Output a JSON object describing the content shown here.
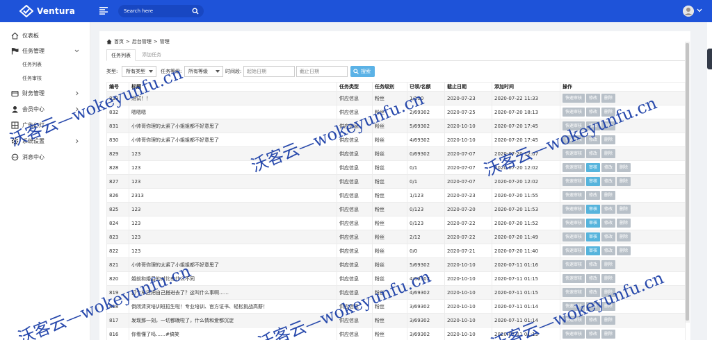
{
  "app": {
    "name": "Ventura"
  },
  "search": {
    "placeholder": "Search here"
  },
  "colors": {
    "topbar": "#1e53d9",
    "accent": "#5bb2e6",
    "review_button": "#56b4dc",
    "action_button": "#b8c0c8"
  },
  "sidebar": {
    "items": [
      {
        "label": "仪表板",
        "icon": "home-icon"
      },
      {
        "label": "任务管理",
        "icon": "flag-icon",
        "expanded": true,
        "children": [
          {
            "label": "任务列表"
          },
          {
            "label": "任务审核"
          }
        ]
      },
      {
        "label": "财务管理",
        "icon": "wallet-icon"
      },
      {
        "label": "会员中心",
        "icon": "user-icon"
      },
      {
        "label": "广告幻灯",
        "icon": "grid-icon"
      },
      {
        "label": "系统设置",
        "icon": "gear-icon"
      },
      {
        "label": "消息中心",
        "icon": "message-icon"
      }
    ]
  },
  "breadcrumb": {
    "items": [
      "首页",
      "后台管理",
      "管理"
    ],
    "separator": ">"
  },
  "tabs": [
    {
      "label": "任务列表",
      "active": true
    },
    {
      "label": "添加任务",
      "active": false
    }
  ],
  "filters": {
    "type_label": "类型:",
    "type_value": "所有类型",
    "level_label": "任务等级:",
    "level_value": "所有等级",
    "time_label": "时间段:",
    "start_placeholder": "起始日期",
    "end_placeholder": "截止日期",
    "search_button": "搜索"
  },
  "table": {
    "columns": [
      "编号",
      "标题",
      "任务类型",
      "任务级别",
      "已领/名额",
      "截止日期",
      "添加时间",
      "操作"
    ],
    "action_labels": {
      "quick": "快速审核",
      "review": "审核",
      "edit": "修改",
      "delete": "删除"
    },
    "rows": [
      {
        "id": "833",
        "title": "测试！！",
        "type": "供应信息",
        "level": "粉丝",
        "quota": "1/100",
        "deadline": "2020-07-23",
        "added": "2020-07-22 11:33",
        "review": false
      },
      {
        "id": "832",
        "title": "嗯嗯嗯",
        "type": "供应信息",
        "level": "粉丝",
        "quota": "2/69302",
        "deadline": "2020-07-25",
        "added": "2020-07-20 18:13",
        "review": false
      },
      {
        "id": "831",
        "title": "小帅哥你理的太紧了小姐姐都不好意思了",
        "type": "供应信息",
        "level": "粉丝",
        "quota": "5/69302",
        "deadline": "2020-10-10",
        "added": "2020-07-20 17:45",
        "review": false
      },
      {
        "id": "830",
        "title": "小帅哥你理的太紧了小姐姐都不好意思了",
        "type": "供应信息",
        "level": "粉丝",
        "quota": "4/69302",
        "deadline": "2020-10-10",
        "added": "2020-07-20 17:45",
        "review": false
      },
      {
        "id": "829",
        "title": "123",
        "type": "供应信息",
        "level": "粉丝",
        "quota": "0/69302",
        "deadline": "2020-07-07",
        "added": "2020-07-20 12:07",
        "review": false
      },
      {
        "id": "828",
        "title": "123",
        "type": "供应信息",
        "level": "粉丝",
        "quota": "0/1",
        "deadline": "2020-07-07",
        "added": "2020-07-20 12:02",
        "review": true
      },
      {
        "id": "827",
        "title": "123",
        "type": "供应信息",
        "level": "粉丝",
        "quota": "0/1",
        "deadline": "2020-07-07",
        "added": "2020-07-20 12:02",
        "review": true
      },
      {
        "id": "826",
        "title": "2313",
        "type": "供应信息",
        "level": "粉丝",
        "quota": "1/123",
        "deadline": "2020-07-23",
        "added": "2020-07-20 11:55",
        "review": false
      },
      {
        "id": "825",
        "title": "123",
        "type": "供应信息",
        "level": "粉丝",
        "quota": "0/123",
        "deadline": "2020-07-20",
        "added": "2020-07-20 11:53",
        "review": true
      },
      {
        "id": "824",
        "title": "123",
        "type": "供应信息",
        "level": "粉丝",
        "quota": "0/123",
        "deadline": "2020-07-22",
        "added": "2020-07-20 11:52",
        "review": true
      },
      {
        "id": "823",
        "title": "123",
        "type": "供应信息",
        "level": "粉丝",
        "quota": "2/12",
        "deadline": "2020-07-22",
        "added": "2020-07-20 11:49",
        "review": true
      },
      {
        "id": "822",
        "title": "123",
        "type": "供应信息",
        "level": "粉丝",
        "quota": "0/0",
        "deadline": "2020-07-21",
        "added": "2020-07-20 11:40",
        "review": true
      },
      {
        "id": "821",
        "title": "小帅哥你理的太紧了小姐姐都不好意思了",
        "type": "供应信息",
        "level": "粉丝",
        "quota": "5/69302",
        "deadline": "2020-10-10",
        "added": "2020-07-11 01:16",
        "review": false
      },
      {
        "id": "820",
        "title": "婚前和婚后的对比有什么不同",
        "type": "供应信息",
        "level": "粉丝",
        "quota": "4/69302",
        "deadline": "2020-10-10",
        "added": "2020-07-11 01:15",
        "review": false
      },
      {
        "id": "819",
        "title": "打个车还把自己搭进去了？这叫什么事啊……",
        "type": "供应信息",
        "level": "粉丝",
        "quota": "4/69302",
        "deadline": "2020-10-10",
        "added": "2020-07-11 01:15",
        "review": false
      },
      {
        "id": "818",
        "title": "倒闭清货培训班招生啦！专业培训、官方证书、轻松挑战高薪！",
        "type": "供应信息",
        "level": "粉丝",
        "quota": "3/69302",
        "deadline": "2020-10-10",
        "added": "2020-07-11 01:14",
        "review": false
      },
      {
        "id": "817",
        "title": "发现那一刻，一切都晚啦了，什么情和爱都沉淀",
        "type": "供应信息",
        "level": "粉丝",
        "quota": "3/69302",
        "deadline": "2020-10-10",
        "added": "2020-07-11 01:14",
        "review": false
      },
      {
        "id": "816",
        "title": "你看懂了吗……#搞笑",
        "type": "供应信息",
        "level": "粉丝",
        "quota": "3/69302",
        "deadline": "2020-10-10",
        "added": "2020-07-11 01:13",
        "review": false
      }
    ]
  },
  "watermark": {
    "text": "沃客云—wokeyunfu.cn"
  }
}
